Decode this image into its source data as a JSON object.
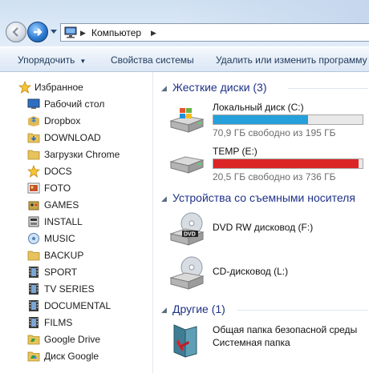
{
  "address": {
    "crumb": "Компьютер"
  },
  "toolbar": {
    "organize": "Упорядочить",
    "system_props": "Свойства системы",
    "uninstall": "Удалить или изменить программу"
  },
  "sidebar": {
    "favorites": "Избранное",
    "items": [
      {
        "label": "Рабочий стол",
        "icon": "desktop-icon"
      },
      {
        "label": "Dropbox",
        "icon": "dropbox-icon"
      },
      {
        "label": "DOWNLOAD",
        "icon": "folder-download-icon"
      },
      {
        "label": "Загрузки Chrome",
        "icon": "folder-icon"
      },
      {
        "label": "DOCS",
        "icon": "star-icon"
      },
      {
        "label": "FOTO",
        "icon": "photo-icon"
      },
      {
        "label": "GAMES",
        "icon": "games-icon"
      },
      {
        "label": "INSTALL",
        "icon": "install-icon"
      },
      {
        "label": "MUSIC",
        "icon": "music-icon"
      },
      {
        "label": "BACKUP",
        "icon": "folder-icon"
      },
      {
        "label": "SPORT",
        "icon": "film-icon"
      },
      {
        "label": "TV SERIES",
        "icon": "film-icon"
      },
      {
        "label": "DOCUMENTAL",
        "icon": "film-icon"
      },
      {
        "label": "FILMS",
        "icon": "film-icon"
      },
      {
        "label": "Google Drive",
        "icon": "google-drive-icon"
      },
      {
        "label": "Диск Google",
        "icon": "google-drive-icon"
      }
    ]
  },
  "groups": {
    "hard_disks": "Жесткие диски (3)",
    "removable": "Устройства со съемными носителя",
    "other": "Другие (1)"
  },
  "drives": [
    {
      "name": "Локальный диск (C:)",
      "free": "70,9 ГБ свободно из 195 ГБ",
      "used_fraction": 0.636,
      "color": "#26a0da"
    },
    {
      "name": "TEMP (E:)",
      "free": "20,5 ГБ свободно из 736 ГБ",
      "used_fraction": 0.972,
      "color": "#da2626"
    }
  ],
  "removable": [
    {
      "name": "DVD RW дисковод (F:)"
    },
    {
      "name": "CD-дисковод (L:)"
    }
  ],
  "other": {
    "name": "Общая папка безопасной среды",
    "sub": "Системная папка"
  }
}
